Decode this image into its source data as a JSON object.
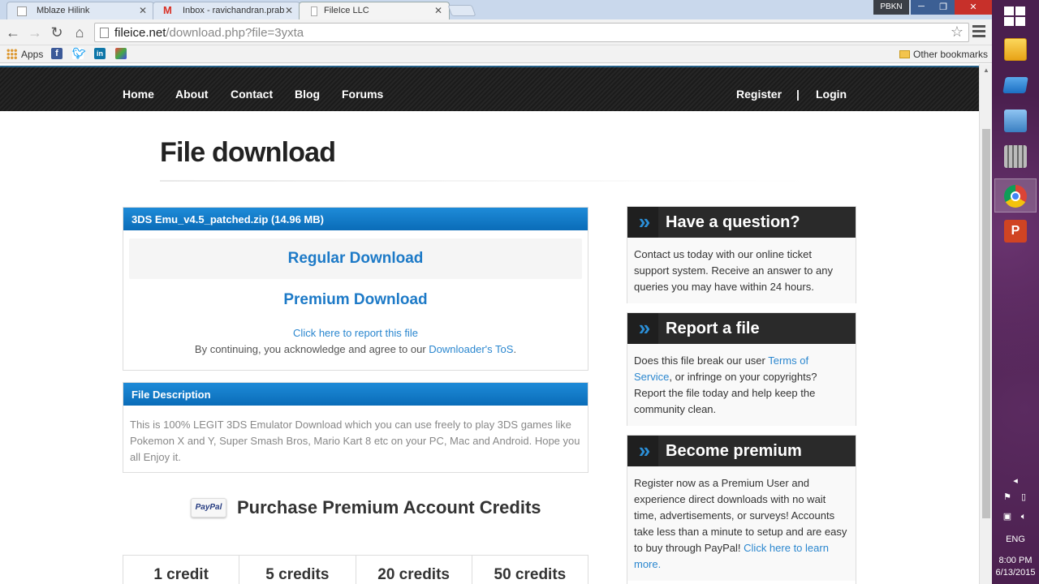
{
  "browser": {
    "tabs": [
      {
        "title": "Mblaze Hilink",
        "active": false
      },
      {
        "title": "Inbox - ravichandran.prab",
        "active": false
      },
      {
        "title": "FileIce LLC",
        "active": true
      }
    ],
    "profile": "PBKN",
    "url_host": "fileice.net",
    "url_path": "/download.php?file=3yxta",
    "bookmarks": {
      "apps_label": "Apps",
      "other_label": "Other bookmarks"
    }
  },
  "site": {
    "nav": {
      "home": "Home",
      "about": "About",
      "contact": "Contact",
      "blog": "Blog",
      "forums": "Forums",
      "register": "Register",
      "separator": "|",
      "login": "Login"
    },
    "page_title": "File download",
    "download": {
      "file_header": "3DS Emu_v4.5_patched.zip (14.96 MB)",
      "regular": "Regular Download",
      "premium": "Premium Download",
      "report_link": "Click here to report this file",
      "tos_prefix": "By continuing, you acknowledge and agree to our ",
      "tos_link": "Downloader's ToS",
      "tos_suffix": "."
    },
    "description": {
      "header": "File Description",
      "text": "This is 100% LEGIT 3DS Emulator Download which you can use freely to play 3DS games like Pokemon X and Y, Super Smash Bros, Mario Kart 8 etc on your PC, Mac and Android. Hope you all Enjoy it."
    },
    "purchase": {
      "paypal_badge": "PayPal",
      "title": "Purchase Premium Account Credits",
      "credits": [
        "1 credit",
        "5 credits",
        "20 credits",
        "50 credits"
      ]
    },
    "sidebar": {
      "question": {
        "title": "Have a question?",
        "body": "Contact us today with our online ticket support system. Receive an answer to any queries you may have within 24 hours."
      },
      "report": {
        "title": "Report a file",
        "body_1": "Does this file break our user ",
        "link": "Terms of Service",
        "body_2": ", or infringe on your copyrights? Report the file today and help keep the community clean."
      },
      "premium": {
        "title": "Become premium",
        "body": "Register now as a Premium User and experience direct downloads with no wait time, advertisements, or surveys! Accounts take less than a minute to setup and are easy to buy through PayPal! ",
        "link": "Click here to learn more."
      }
    }
  },
  "taskbar": {
    "language": "ENG",
    "time": "8:00 PM",
    "date": "6/13/2015"
  },
  "colors": {
    "accent_blue": "#1d7ac7",
    "panel_head_blue": "#0a6cb8",
    "nav_dark": "#1e1e1e",
    "sidebar_head": "#2a2a2a"
  }
}
